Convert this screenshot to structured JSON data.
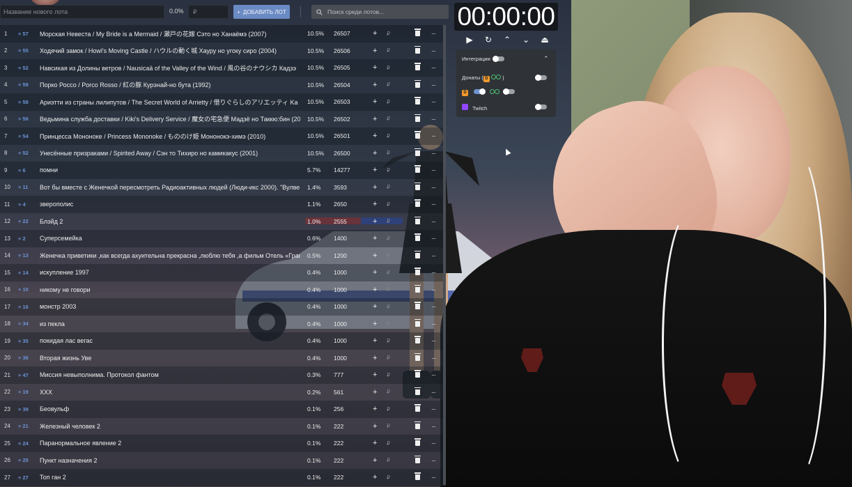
{
  "topbar": {
    "lot_name_placeholder": "Название нового лота",
    "percent_value": "0.0%",
    "amount_placeholder": "₽",
    "add_button_label": "ДОБАВИТЬ ЛОТ",
    "search_placeholder": "Поиск среди лотов..."
  },
  "lots": [
    {
      "num": "1",
      "id": "≡ 57",
      "name": "Морская Невеста / My Bride is a Mermaid / 瀬戸の花嫁 Сэто но Ханаёмэ (2007)",
      "pct": "10.5%",
      "amount": "26507"
    },
    {
      "num": "2",
      "id": "≡ 55",
      "name": "Ходячий замок / Howl's Moving Castle / ハウルの動く城 Хауру но угоку сиро (2004)",
      "pct": "10.5%",
      "amount": "26506"
    },
    {
      "num": "3",
      "id": "≡ 52",
      "name": "Навсикая из Долины ветров / Nausicaä of the Valley of the Wind / 風の谷のナウシカ Кадзэ",
      "pct": "10.5%",
      "amount": "26505"
    },
    {
      "num": "4",
      "id": "≡ 59",
      "name": "Порко Россо / Porco Rosso / 紅の豚 Курэнай-но бута (1992)",
      "pct": "10.5%",
      "amount": "26504"
    },
    {
      "num": "5",
      "id": "≡ 58",
      "name": "Ариэтти из страны лилипутов / The Secret World of Arrietty / 借りぐらしのアリエッティ Ka",
      "pct": "10.5%",
      "amount": "26503"
    },
    {
      "num": "6",
      "id": "≡ 56",
      "name": "Ведьмина служба доставки / Kiki's Delivery Service / 魔女の宅急便 Мадзё но Таккю:бин (20",
      "pct": "10.5%",
      "amount": "26502"
    },
    {
      "num": "7",
      "id": "≡ 54",
      "name": "Принцесса Мононоке / Princess Mononoke / もののけ姫 Мононокэ-химэ (2010)",
      "pct": "10.5%",
      "amount": "26501"
    },
    {
      "num": "8",
      "id": "≡ 52",
      "name": "Унесённые призраками / Spirited Away / Сэн то Тихиро но камикакус (2001)",
      "pct": "10.5%",
      "amount": "26500"
    },
    {
      "num": "9",
      "id": "≡ 6",
      "name": "помни",
      "pct": "5.7%",
      "amount": "14277"
    },
    {
      "num": "10",
      "id": "≡ 11",
      "name": "Вот бы вместе с Женечкой пересмотреть Радиоактивных людей (Люди-икс 2000). \"Вулве",
      "pct": "1.4%",
      "amount": "3593"
    },
    {
      "num": "11",
      "id": "≡ 4",
      "name": "зверополис",
      "pct": "1.1%",
      "amount": "2650"
    },
    {
      "num": "12",
      "id": "≡ 22",
      "name": "Блэйд 2",
      "pct": "1.0%",
      "amount": "2555"
    },
    {
      "num": "13",
      "id": "≡ 2",
      "name": "Суперсемейка",
      "pct": "0.6%",
      "amount": "1400"
    },
    {
      "num": "14",
      "id": "≡ 13",
      "name": "Женечка приветики ,как всегда ахуительна прекрасна ,люблю тебя ,а фильм Отель «Гран",
      "pct": "0.5%",
      "amount": "1200"
    },
    {
      "num": "15",
      "id": "≡ 14",
      "name": "искупление 1997",
      "pct": "0.4%",
      "amount": "1000"
    },
    {
      "num": "16",
      "id": "≡ 15",
      "name": "никому не говори",
      "pct": "0.4%",
      "amount": "1000"
    },
    {
      "num": "17",
      "id": "≡ 16",
      "name": "монстр 2003",
      "pct": "0.4%",
      "amount": "1000"
    },
    {
      "num": "18",
      "id": "≡ 34",
      "name": "из пекла",
      "pct": "0.4%",
      "amount": "1000"
    },
    {
      "num": "19",
      "id": "≡ 35",
      "name": "покидая лас вегас",
      "pct": "0.4%",
      "amount": "1000"
    },
    {
      "num": "20",
      "id": "≡ 36",
      "name": "Вторая жизнь Уве",
      "pct": "0.4%",
      "amount": "1000"
    },
    {
      "num": "21",
      "id": "≡ 47",
      "name": "Миссия невыполнима. Протокол фантом",
      "pct": "0.3%",
      "amount": "777"
    },
    {
      "num": "22",
      "id": "≡ 19",
      "name": "XXX",
      "pct": "0.2%",
      "amount": "561"
    },
    {
      "num": "23",
      "id": "≡ 39",
      "name": "Беовульф",
      "pct": "0.1%",
      "amount": "256"
    },
    {
      "num": "24",
      "id": "≡ 21",
      "name": "Железный человек 2",
      "pct": "0.1%",
      "amount": "222"
    },
    {
      "num": "25",
      "id": "≡ 24",
      "name": "Паранормальное явление 2",
      "pct": "0.1%",
      "amount": "222"
    },
    {
      "num": "26",
      "id": "≡ 25",
      "name": "Пункт назначения 2",
      "pct": "0.1%",
      "amount": "222"
    },
    {
      "num": "27",
      "id": "≡ 27",
      "name": "Топ ган 2",
      "pct": "0.1%",
      "amount": "222"
    }
  ],
  "row_actions": {
    "add": "+",
    "currency": "₽",
    "more": "···"
  },
  "timer": {
    "value": "00:00:00"
  },
  "controls": [
    {
      "name": "play-icon",
      "glyph": "▶"
    },
    {
      "name": "reset-icon",
      "glyph": "↻"
    },
    {
      "name": "chevron-up-icon",
      "glyph": "⌃"
    },
    {
      "name": "chevron-down-icon",
      "glyph": "⌄"
    },
    {
      "name": "eject-icon",
      "glyph": "⏏"
    }
  ],
  "integrations": {
    "header": "Интеграции",
    "donations_label": "Донаты",
    "twitch_label": "Twitch",
    "da_badge": "D",
    "paren_open": "(",
    "paren_close": ")"
  },
  "colors": {
    "accent": "#6a8ac4",
    "id_blue": "#6b93d6",
    "panel_bg": "#2f3338",
    "donation_orange": "#f59a2c",
    "twitch_purple": "#9146ff"
  }
}
